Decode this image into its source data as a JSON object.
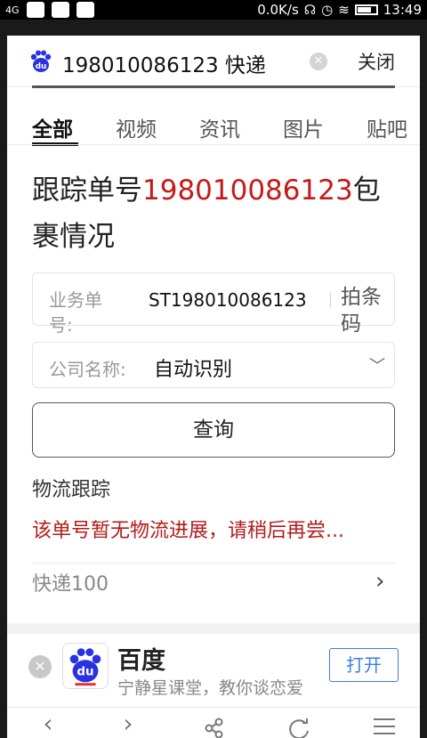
{
  "status_bar": {
    "network": "4G",
    "speed": "0.0K/s",
    "time": "13:49"
  },
  "header": {
    "query": "198010086123 快递",
    "close_label": "关闭"
  },
  "tabs": [
    {
      "label": "全部",
      "active": true
    },
    {
      "label": "视频",
      "active": false
    },
    {
      "label": "资讯",
      "active": false
    },
    {
      "label": "图片",
      "active": false
    },
    {
      "label": "贴吧",
      "active": false
    }
  ],
  "result": {
    "title_prefix": "跟踪单号",
    "tracking_number": "198010086123",
    "title_suffix": "包裹情况"
  },
  "form": {
    "tracking_label": "业务单号:",
    "tracking_value": "ST198010086123",
    "scan_label": "拍条码",
    "company_label": "公司名称:",
    "company_value": "自动识别",
    "query_button": "查询"
  },
  "logistics": {
    "title": "物流跟踪",
    "message": "该单号暂无物流进展，请稍后再尝...",
    "source": "快递100"
  },
  "banner": {
    "app_name": "百度",
    "slogan": "宁静星课堂，教你谈恋爱",
    "open_label": "打开"
  },
  "colors": {
    "accent_red": "#c41a1a",
    "link_blue": "#3a7fe0",
    "baidu_blue": "#2932e1"
  }
}
